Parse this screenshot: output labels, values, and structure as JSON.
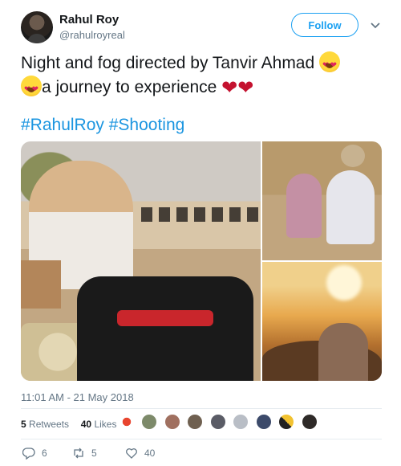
{
  "author": {
    "name": "Rahul Roy",
    "handle": "@rahulroyreal",
    "follow_label": "Follow"
  },
  "tweet": {
    "text_line1": "Night and fog directed by Tanvir Ahmad",
    "text_line2": "a journey to experience",
    "hashtags": [
      "#RahulRoy",
      "#Shooting"
    ],
    "timestamp": "11:01 AM - 21 May 2018"
  },
  "stats": {
    "retweets_count": "5",
    "retweets_label": "Retweets",
    "likes_count": "40",
    "likes_label": "Likes"
  },
  "actions": {
    "replies": "6",
    "retweets": "5",
    "likes": "40"
  },
  "colors": {
    "accent": "#1da1f2",
    "hashtag": "#1b95e0",
    "muted": "#657786",
    "heart": "#c4122f"
  },
  "icons": [
    "chevron-down-icon",
    "heart-eyes-emoji",
    "red-heart-emoji",
    "reply-icon",
    "retweet-icon",
    "like-icon"
  ]
}
